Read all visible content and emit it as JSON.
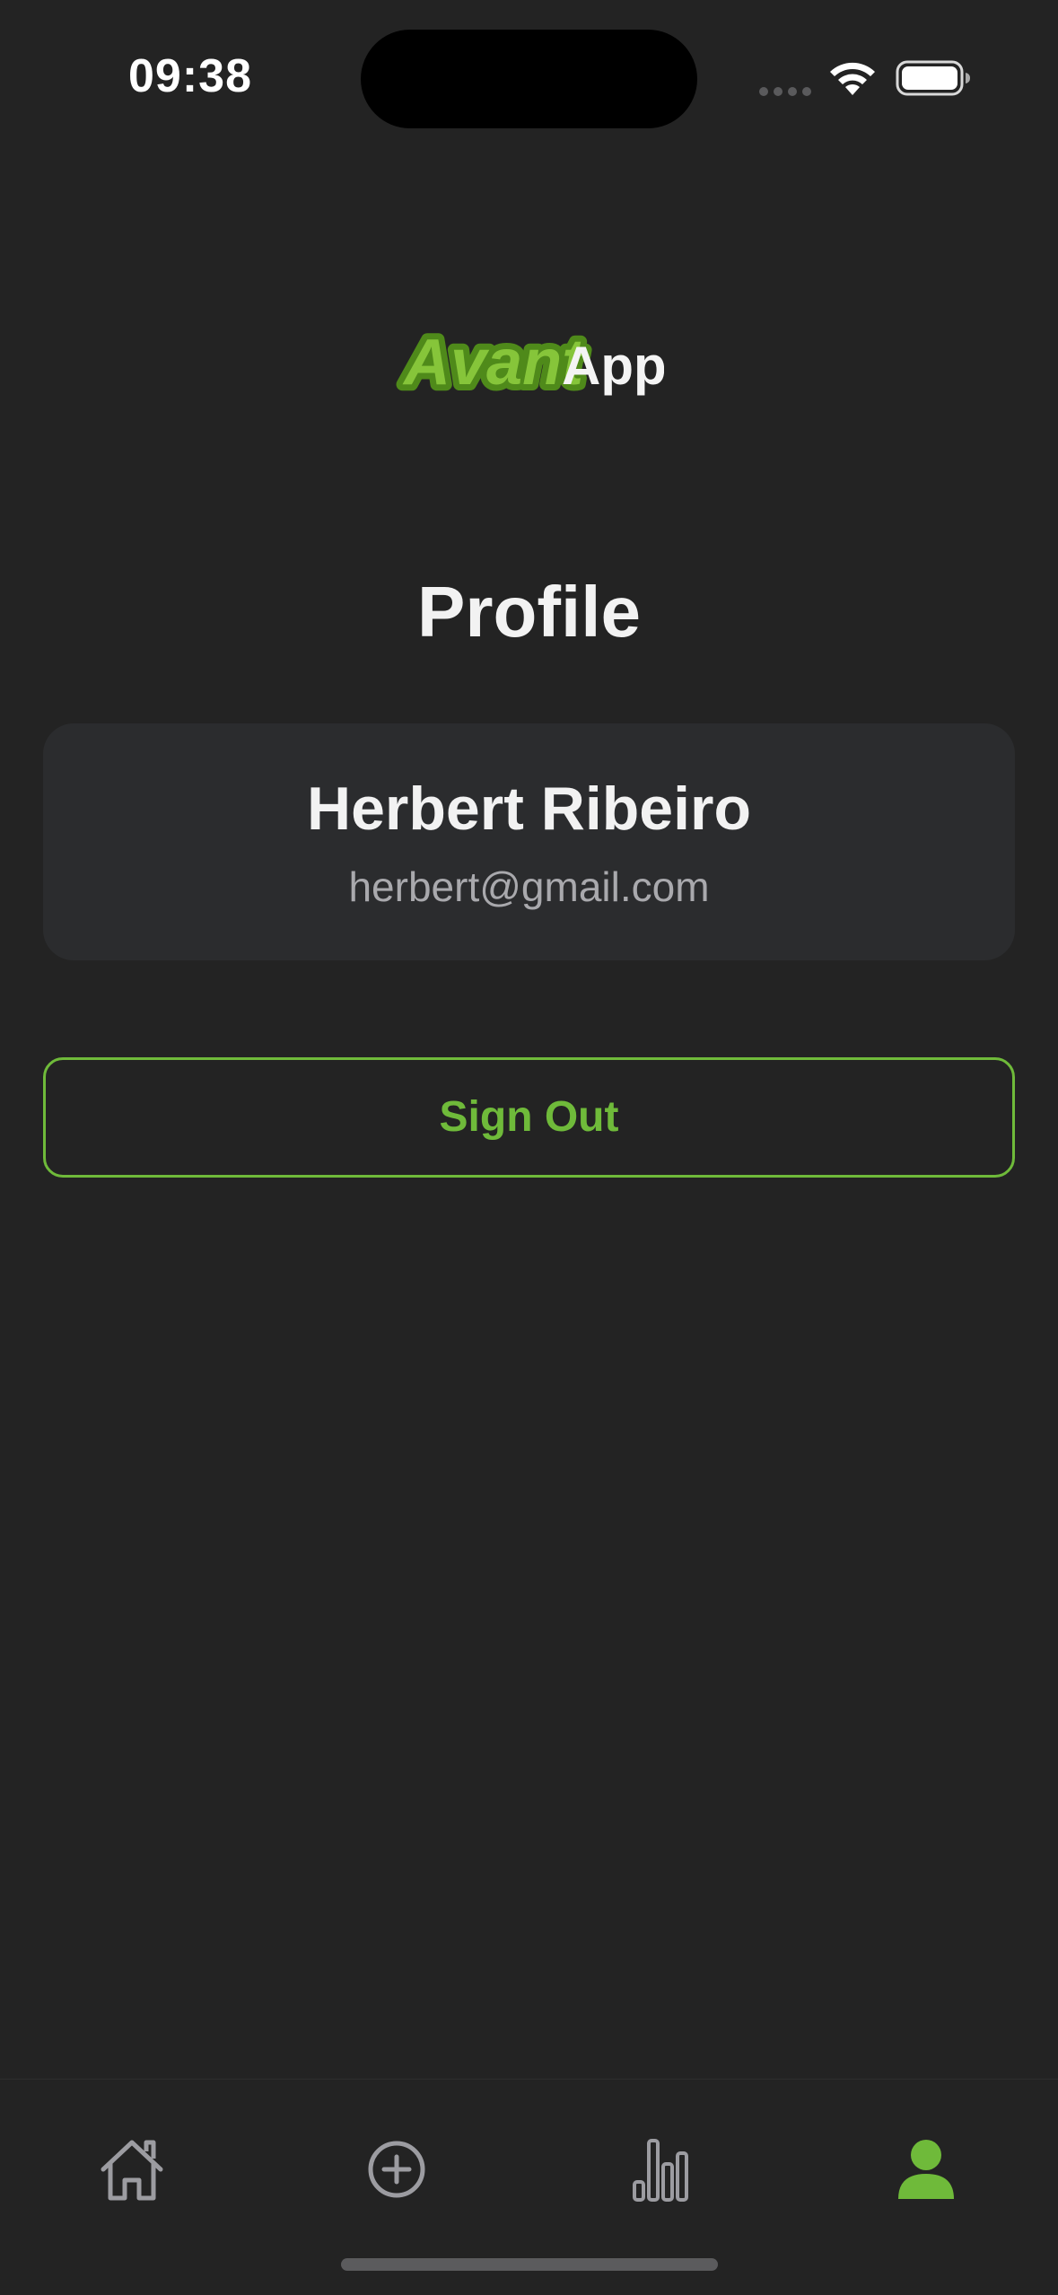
{
  "status_bar": {
    "time": "09:38"
  },
  "logo": {
    "part1": "Avant",
    "part2": "App",
    "brand_green": "#7ec22a"
  },
  "page": {
    "title": "Profile"
  },
  "profile": {
    "name": "Herbert Ribeiro",
    "email": "herbert@gmail.com"
  },
  "actions": {
    "sign_out_label": "Sign Out"
  },
  "tab_bar": {
    "items": [
      {
        "icon": "home-icon",
        "active": false
      },
      {
        "icon": "add-circle-icon",
        "active": false
      },
      {
        "icon": "bar-chart-icon",
        "active": false
      },
      {
        "icon": "person-icon",
        "active": true
      }
    ],
    "active_color": "#6fba3a",
    "inactive_color": "#9c9ca1"
  }
}
